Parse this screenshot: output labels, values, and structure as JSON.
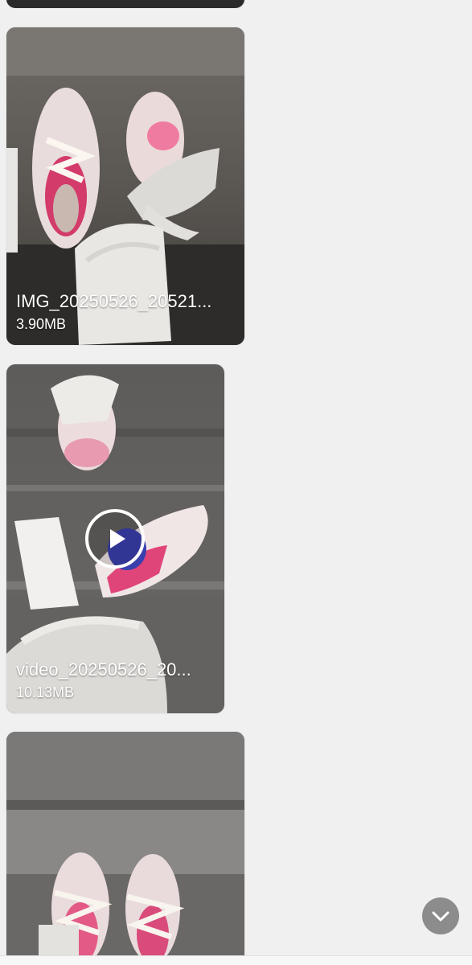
{
  "messages": [
    {
      "type": "image",
      "filename": "IMG_20250526_20521...",
      "size": "3.90MB"
    },
    {
      "type": "video",
      "filename": "video_20250526_20...",
      "size": "10.13MB"
    },
    {
      "type": "image",
      "filename": "",
      "size": ""
    }
  ],
  "controls": {
    "play_icon": "play-icon",
    "scroll_down_icon": "chevron-down-icon"
  },
  "colors": {
    "background": "#f0f0f0",
    "caption_text": "#ffffff",
    "scroll_button": "#8c8c8c"
  }
}
